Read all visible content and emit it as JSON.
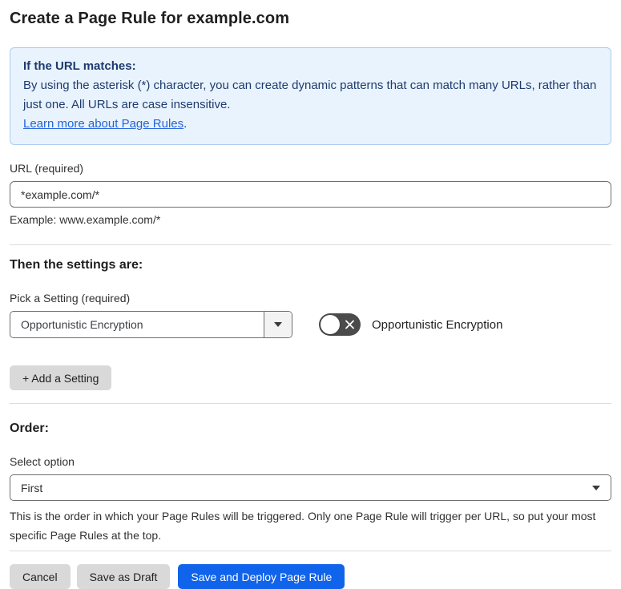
{
  "page": {
    "title": "Create a Page Rule for example.com"
  },
  "info_box": {
    "heading": "If the URL matches:",
    "body": "By using the asterisk (*) character, you can create dynamic patterns that can match many URLs, rather than just one. All URLs are case insensitive.",
    "link_label": "Learn more about Page Rules",
    "link_suffix": "."
  },
  "url_field": {
    "label": "URL (required)",
    "value": "*example.com/*",
    "example": "Example: www.example.com/*"
  },
  "settings_section": {
    "heading": "Then the settings are:",
    "picker_label": "Pick a Setting (required)",
    "selected_setting": "Opportunistic Encryption",
    "toggle_label": "Opportunistic Encryption",
    "toggle_state": "off",
    "add_setting_label": "+ Add a Setting"
  },
  "order_section": {
    "heading": "Order:",
    "select_label": "Select option",
    "selected_option": "First",
    "help_text": "This is the order in which your Page Rules will be triggered. Only one Page Rule will trigger per URL, so put your most specific Page Rules at the top."
  },
  "footer": {
    "cancel_label": "Cancel",
    "save_draft_label": "Save as Draft",
    "save_deploy_label": "Save and Deploy Page Rule"
  },
  "colors": {
    "info_box_bg": "#e9f3fd",
    "info_box_border": "#abcdf0",
    "info_box_text": "#1e3b6e",
    "link_blue": "#2563d9",
    "primary_button_blue": "#1063eb",
    "gray_button_bg": "#d9d9d9",
    "toggle_off_bg": "#4b4b4b",
    "input_border": "#6e6e6e",
    "divider": "#dcdcdc"
  }
}
